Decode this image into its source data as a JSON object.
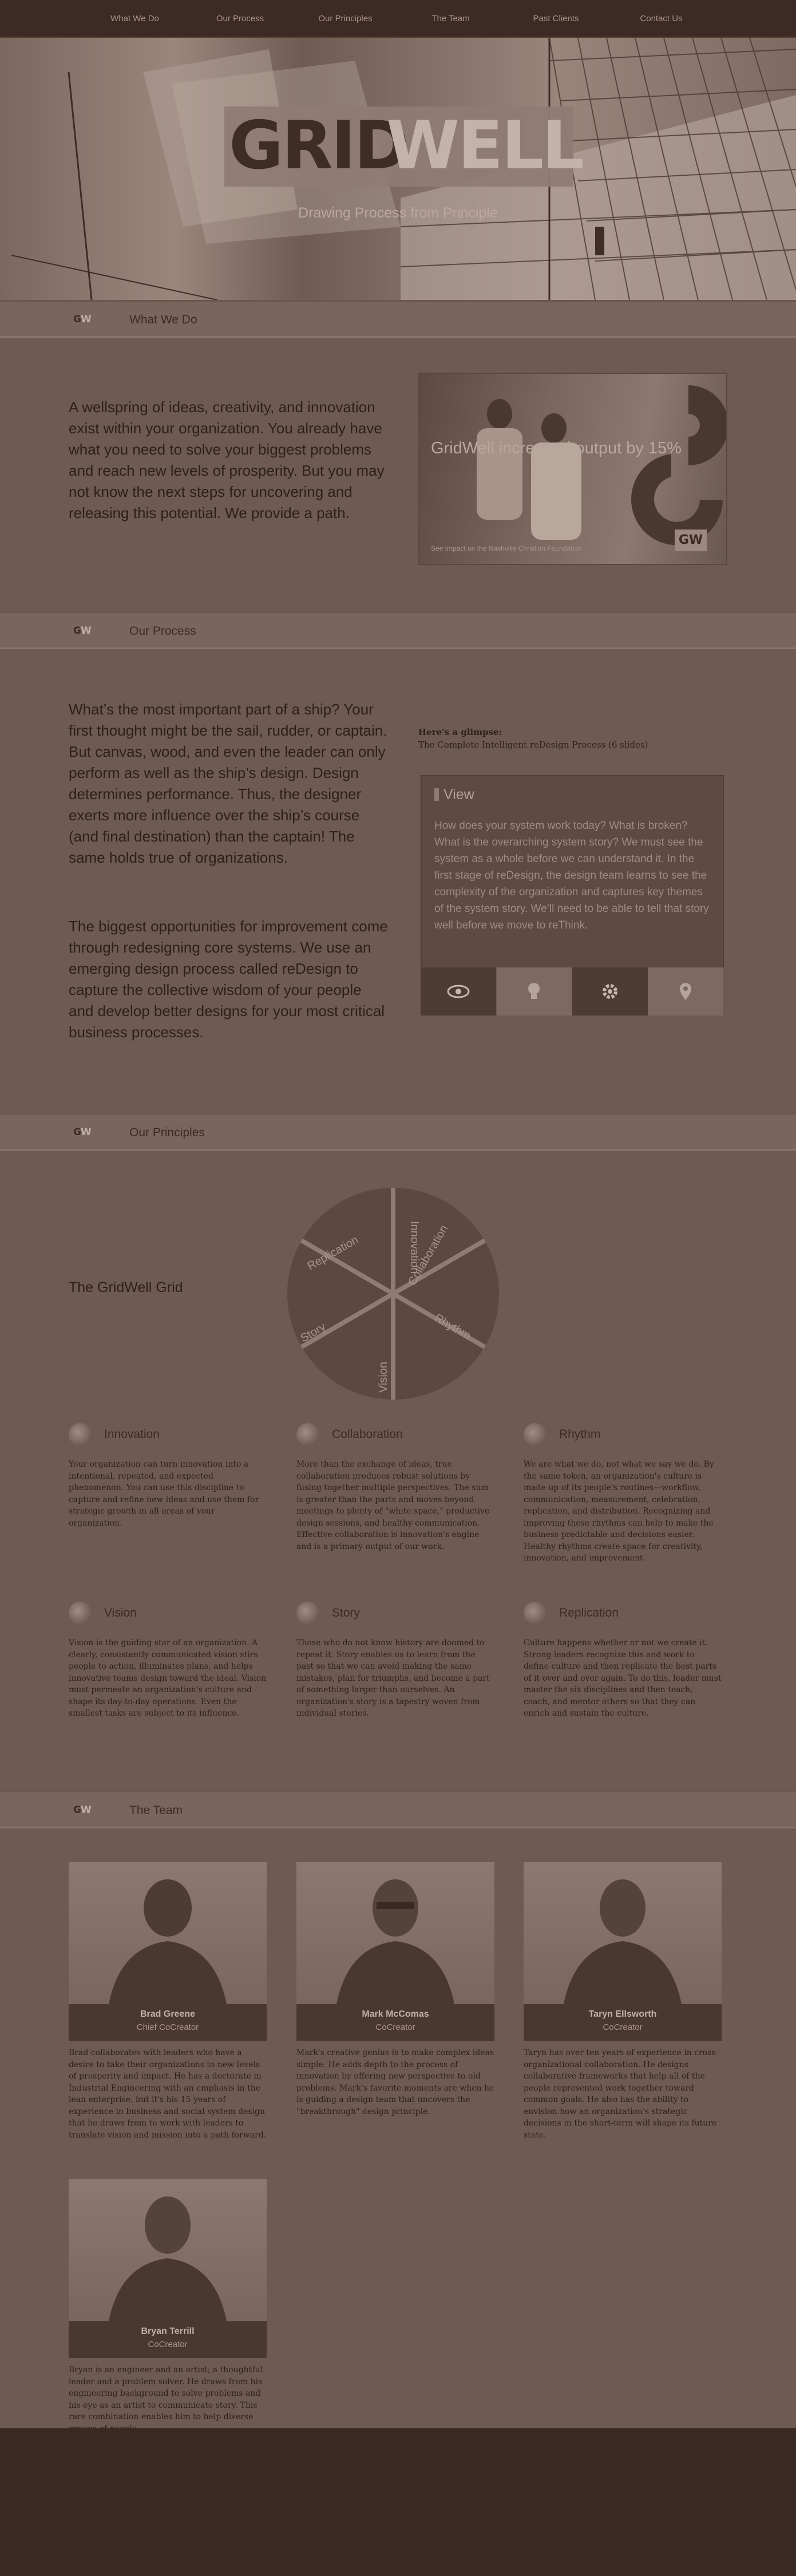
{
  "nav": {
    "items": [
      "What We Do",
      "Our Process",
      "Our Principles",
      "The Team",
      "Past Clients",
      "Contact Us"
    ]
  },
  "hero": {
    "logo_part1": "GRID",
    "logo_part2": "WELL",
    "tagline": "Drawing Process from Principle"
  },
  "sections": {
    "what_we_do": "What We Do",
    "our_process": "Our Process",
    "our_principles": "Our Principles",
    "the_team": "The Team"
  },
  "brand_mark": {
    "g": "G",
    "w": "W"
  },
  "what_we_do": {
    "lead": "A wellspring of ideas, creativity, and innovation exist within your organization. You already have what you need to solve your biggest problems and reach new levels of prosperity. But you may not know the next steps for uncovering and releasing this potential. We provide a path.",
    "photo_title": "GridWell increased output by 15%",
    "photo_caption": "See Impact on the Nashville Christian Foundation",
    "photo_mark": "GW"
  },
  "process": {
    "p1": "What’s the most important part of a ship? Your first thought might be the sail, rudder, or captain. But canvas, wood, and even the leader can only perform as well as the ship’s design. Design determines performance. Thus, the designer exerts more influence over the ship’s course (and final destination) than the captain! The same holds true of organizations.",
    "p2": "The biggest opportunities for improvement come through redesigning core systems. We use an emerging design process called reDesign to capture the collective wisdom of your people and develop better designs for your most critical business processes.",
    "glimpse_heading": "Here's a glimpse:",
    "glimpse_link": "The Complete Intelligent reDesign Process (6 slides)",
    "card_title": "View",
    "card_body": "How does your system work today? What is broken? What is the overarching system story? We must see the system as a whole before we can understand it. In the first stage of reDesign, the design team learns to see the complexity of the organization and captures key themes of the system story. We’ll need to be able to tell that story well before we move to reThink.",
    "tabs": [
      "eye-icon",
      "lightbulb-icon",
      "gear-icon",
      "pin-icon"
    ]
  },
  "principles": {
    "grid_title": "The GridWell Grid",
    "wheel": [
      "Innovation",
      "Collaboration",
      "Rhythm",
      "Vision",
      "Story",
      "Replication"
    ],
    "items": [
      {
        "title": "Innovation",
        "desc": "Your organization can turn innovation into a intentional, repeated, and expected phenomenon. You can use this discipline to capture and refine new ideas and use them for strategic growth in all areas of your organization."
      },
      {
        "title": "Collaboration",
        "desc": "More than the exchange of ideas, true collaboration produces robust solutions by fusing together multiple perspectives. The sum is greater than the parts and moves beyond meetings to plenty of \"white space,\" productive design sessions, and healthy communication. Effective collaboration is innovation's engine and is a primary output of our work."
      },
      {
        "title": "Rhythm",
        "desc": "We are what we do, not what we say we do. By the same token, an organization's culture is made up of its people's routines—workflow, communication, measurement, celebration, replication, and distribution. Recognizing and improving these rhythms can help to make the business predictable and decisions easier. Healthy rhythms create space for creativity, innovation, and improvement."
      },
      {
        "title": "Vision",
        "desc": "Vision is the guiding star of an organization. A clearly, consistently communicated vision stirs people to action, illuminates plans, and helps innovative teams design toward the ideal. Vision must permeate an organization's culture and shape its day-to-day operations. Even the smallest tasks are subject to its influence."
      },
      {
        "title": "Story",
        "desc": "Those who do not know history are doomed to repeat it. Story enables us to learn from the past so that we can avoid making the same mistakes, plan for triumphs, and become a part of something larger than ourselves. An organization's story is a tapestry woven from individual stories."
      },
      {
        "title": "Replication",
        "desc": "Culture happens whether or not we create it. Strong leaders recognize this and work to define culture and then replicate the best parts of it over and over again. To do this, leader must master the six disciplines and then teach, coach, and mentor others so that they can enrich and sustain the culture."
      }
    ]
  },
  "team": {
    "members": [
      {
        "name": "Brad Greene",
        "role": "Chief CoCreator",
        "bio": "Brad collaborates with leaders who have a desire to take their organizations to new levels of prosperity and impact. He has a doctorate in Industrial Engineering with an emphasis in the lean enterprise, but it's his 15 years of experience in business and social system design that he draws from to work with leaders to translate vision and mission into a path forward."
      },
      {
        "name": "Mark McComas",
        "role": "CoCreator",
        "bio": "Mark's creative genius is to make complex ideas simple. He adds depth to the process of innovation by offering new perspective to old problems. Mark's favorite moments are when he is guiding a design team that uncovers the \"breakthrough\" design principle."
      },
      {
        "name": "Taryn Ellsworth",
        "role": "CoCreator",
        "bio": "Taryn has over ten years of experience in cross-organizational collaboration. He designs collaborative frameworks that help all of the people represented work together toward common goals. He also has the ability to envision how an organization's strategic decisions in the short-term will shape its future state."
      },
      {
        "name": "Bryan Terrill",
        "role": "CoCreator",
        "bio": "Bryan is an engineer and an artist; a thoughtful leader and a problem solver. He draws from his engineering background to solve problems and his eye as an artist to communicate story. This rare combination enables him to help diverse groups of people"
      }
    ]
  },
  "colors": {
    "overlay": "#3a2822",
    "panel": "#6e5a51",
    "bar": "#7a655c"
  }
}
